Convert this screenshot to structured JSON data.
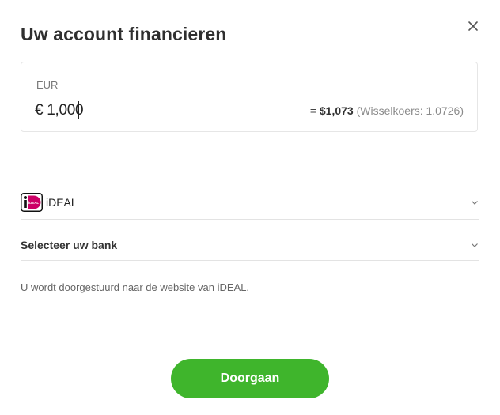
{
  "dialog": {
    "title": "Uw account financieren"
  },
  "amount": {
    "currency_label": "EUR",
    "value": "€ 1,000",
    "converted_prefix": "= ",
    "converted": "$1,073",
    "exchange_rate": "(Wisselkoers: 1.0726)"
  },
  "payment": {
    "method_label": "iDEAL",
    "logo_text": "iDEAL",
    "bank_placeholder": "Selecteer uw bank",
    "redirect_note": "U wordt doorgestuurd naar de website van iDEAL."
  },
  "actions": {
    "continue_label": "Doorgaan"
  },
  "colors": {
    "primary_button": "#3fb52c",
    "ideal_brand": "#cc0066"
  },
  "icons": {
    "close": "close-icon",
    "chevron": "chevron-down-icon",
    "logo": "ideal-logo"
  }
}
